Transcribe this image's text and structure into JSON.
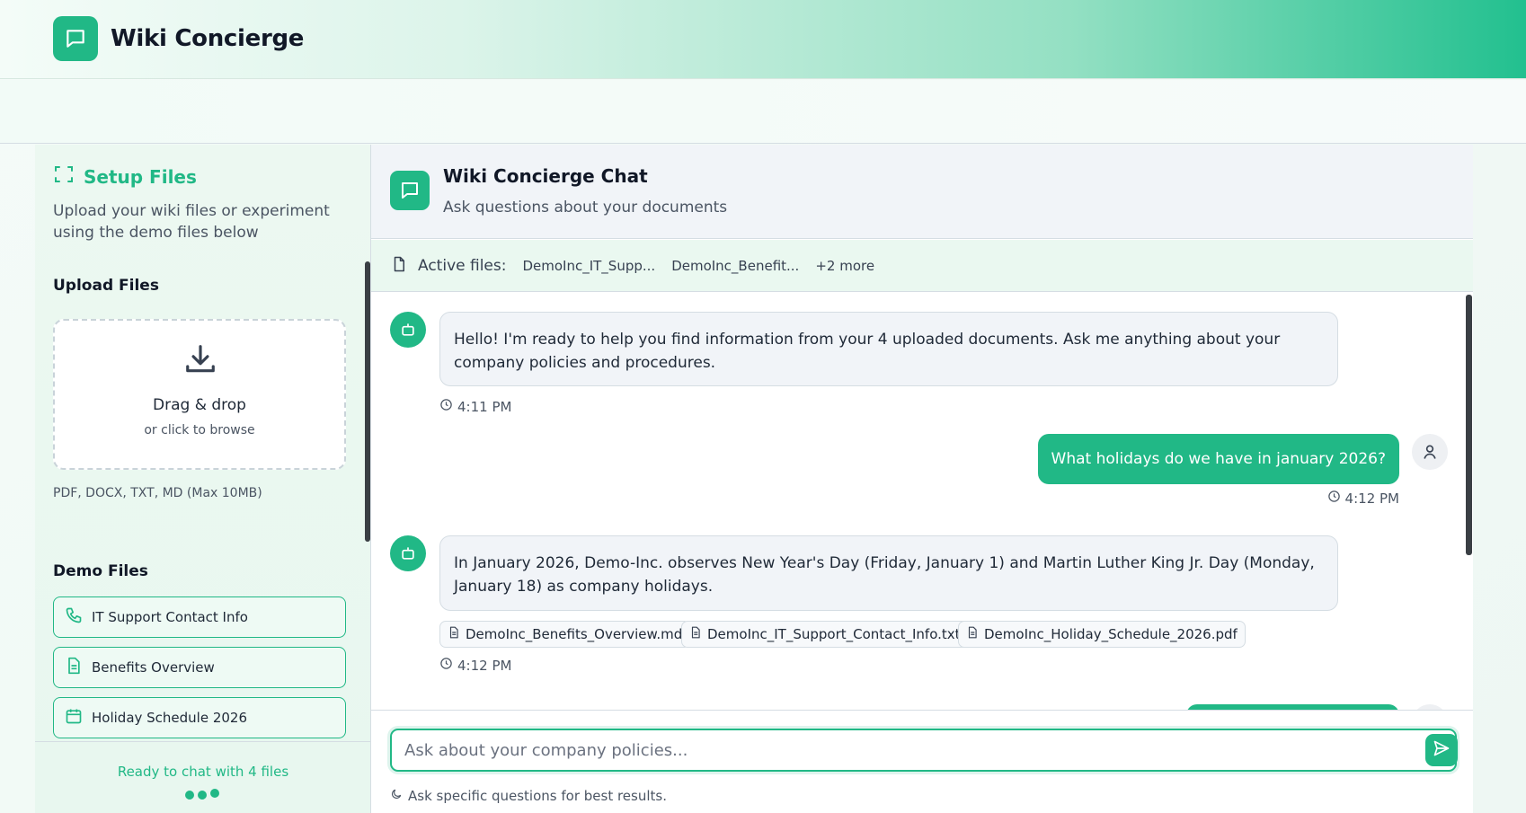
{
  "app": {
    "title": "Wiki Concierge"
  },
  "sidebar": {
    "setup_title": "Setup Files",
    "setup_desc": "Upload your wiki files or experiment using the demo files below",
    "upload_label": "Upload Files",
    "dropzone_title": "Drag & drop",
    "dropzone_sub": "or click to browse",
    "formats": "PDF, DOCX, TXT, MD (Max 10MB)",
    "demo_label": "Demo Files",
    "demo_files": [
      {
        "label": "IT Support Contact Info",
        "icon": "phone-icon"
      },
      {
        "label": "Benefits Overview",
        "icon": "document-icon"
      },
      {
        "label": "Holiday Schedule 2026",
        "icon": "calendar-icon"
      }
    ],
    "ready_text": "Ready to chat with 4 files"
  },
  "chat": {
    "title": "Wiki Concierge Chat",
    "subtitle": "Ask questions about your documents",
    "active_label": "Active files:",
    "active_files": [
      "DemoInc_IT_Supp...",
      "DemoInc_Benefit..."
    ],
    "more": "+2 more",
    "messages": [
      {
        "role": "bot",
        "text": "Hello! I'm ready to help you find information from your 4 uploaded documents. Ask me anything about your company policies and procedures.",
        "time": "4:11 PM"
      },
      {
        "role": "user",
        "text": "What holidays do we have in january 2026?",
        "time": "4:12 PM"
      },
      {
        "role": "bot",
        "text": "In January 2026, Demo-Inc. observes New Year's Day (Friday, January 1) and Martin Luther King Jr. Day (Monday, January 18) as company holidays.",
        "sources": [
          "DemoInc_Benefits_Overview.md",
          "DemoInc_IT_Support_Contact_Info.txt",
          "DemoInc_Holiday_Schedule_2026.pdf"
        ],
        "time": "4:12 PM"
      }
    ],
    "input_placeholder": "Ask about your company policies...",
    "hint": "Ask specific questions for best results."
  },
  "colors": {
    "accent": "#21b886",
    "bubble_bot": "#f1f4f8",
    "text": "#1f2937"
  }
}
